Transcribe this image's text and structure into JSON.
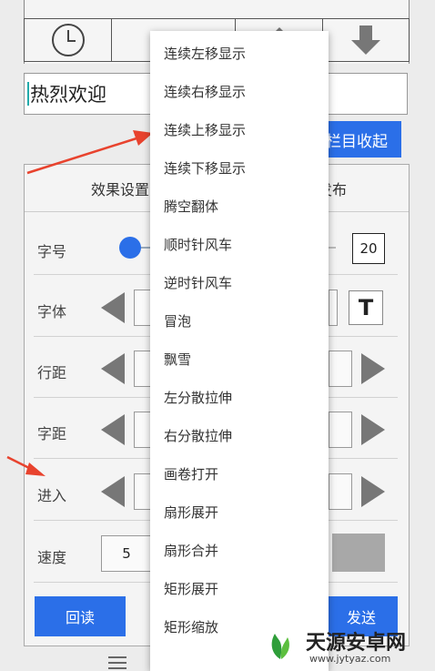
{
  "greeting": {
    "text": "热烈欢迎"
  },
  "collapse_label": "栏目收起",
  "tabs": {
    "effect": "效果设置",
    "publish": "发布"
  },
  "rows": {
    "font_size": {
      "label": "字号",
      "value": "20"
    },
    "font": {
      "label": "字体",
      "bold_label": "T"
    },
    "line_spacing": {
      "label": "行距"
    },
    "char_spacing": {
      "label": "字距"
    },
    "enter": {
      "label": "进入"
    },
    "speed": {
      "label": "速度",
      "value": "5"
    }
  },
  "buttons": {
    "read": "回读",
    "send": "发送"
  },
  "menu_items": [
    "连续左移显示",
    "连续右移显示",
    "连续上移显示",
    "连续下移显示",
    "腾空翻体",
    "顺时针风车",
    "逆时针风车",
    "冒泡",
    "飘雪",
    "左分散拉伸",
    "右分散拉伸",
    "画卷打开",
    "扇形展开",
    "扇形合并",
    "矩形展开",
    "矩形缩放"
  ],
  "watermark": {
    "brand": "天源安卓网",
    "url": "www.jytyaz.com"
  },
  "colors": {
    "accent": "#2b6fe8",
    "arrow": "#e8432e"
  },
  "icons": [
    "clock-icon",
    "up-arrow-icon",
    "down-arrow-icon",
    "menu-icon",
    "home-icon",
    "leaf-logo-icon"
  ]
}
